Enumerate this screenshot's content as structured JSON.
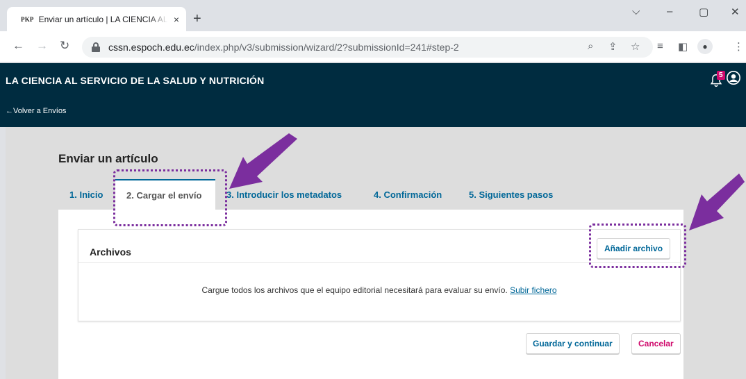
{
  "browser": {
    "tab_favicon": "PKP",
    "tab_title": "Enviar un artículo | LA CIENCIA AL SERVICIO",
    "tab_close": "×",
    "new_tab": "+",
    "url_domain": "cssn.espoch.edu.ec",
    "url_path": "/index.php/v3/submission/wizard/2?submissionId=241#step-2",
    "win_minimize": "–",
    "win_maximize": "▢",
    "win_close": "✕",
    "win_menu": "⌵"
  },
  "header": {
    "site_title": "LA CIENCIA AL SERVICIO DE LA SALUD Y NUTRICIÓN",
    "back_link": "←Volver a Envíos",
    "notification_count": "5"
  },
  "page": {
    "title": "Enviar un artículo",
    "tabs": [
      {
        "label": "1. Inicio"
      },
      {
        "label": "2. Cargar el envío"
      },
      {
        "label": "3. Introducir los metadatos"
      },
      {
        "label": "4. Confirmación"
      },
      {
        "label": "5. Siguientes pasos"
      }
    ],
    "files": {
      "title": "Archivos",
      "add_button": "Añadir archivo",
      "instruction": "Cargue todos los archivos que el equipo editorial necesitará para evaluar su envío.",
      "upload_link": "Subir fichero"
    },
    "save_button": "Guardar y continuar",
    "cancel_button": "Cancelar"
  },
  "colors": {
    "header_bg": "#002c40",
    "link": "#006798",
    "cancel": "#d00a6c",
    "annotation": "#7b2e9e"
  }
}
